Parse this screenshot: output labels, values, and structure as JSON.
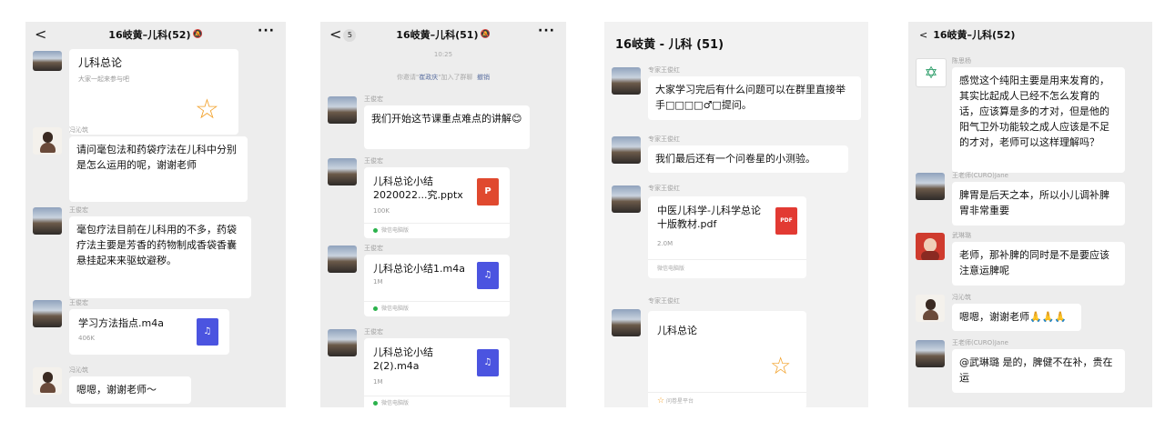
{
  "panel1": {
    "title": "16岐黄–儿科(52)",
    "mute": "🔕",
    "more": "···",
    "back": "<",
    "card_title": "儿科总论",
    "card_sub": "大家一起来参与吧",
    "name_feng": "冯沁筑",
    "msg_question": "请问毫包法和药袋疗法在儿科中分别是怎么运用的呢，谢谢老师",
    "name_wang": "王俊宏",
    "msg_answer": "毫包疗法目前在儿科用的不多，药袋疗法主要是芳香的药物制成香袋香囊悬挂起来来驱蚊避秽。",
    "file_name": "学习方法指点.m4a",
    "file_size": "406K",
    "msg_thanks": "嗯嗯，谢谢老师～"
  },
  "panel2": {
    "title": "16岐黄–儿科(51)",
    "back": "<",
    "unread": "5",
    "more": "···",
    "time": "10:25",
    "sys_prefix": "你邀请\"",
    "sys_name": "崔政庆",
    "sys_suffix": "\"加入了群聊",
    "sys_revoke": "撤销",
    "sender": "王俊宏",
    "msg_intro": "我们开始这节课重点难点的讲解😊",
    "file1_name": "儿科总论小结2020022...究.pptx",
    "file1_size": "100K",
    "file1_src": "微信电脑版",
    "file1_icon": "P",
    "file2_name": "儿科总论小结1.m4a",
    "file2_size": "1M",
    "file2_src": "微信电脑版",
    "file3_name": "儿科总论小结2(2).m4a",
    "file3_size": "1M",
    "file3_src": "微信电脑版",
    "audio_icon": "♫"
  },
  "panel3": {
    "title": "16岐黄 - 儿科 (51)",
    "sender": "专家王俊红",
    "msg1": "大家学习完后有什么问题可以在群里直接举手□□□□♂□提问。",
    "msg2": "我们最后还有一个问卷星的小测验。",
    "file_name": "中医儿科学-儿科学总论十版教材.pdf",
    "file_size": "2.0M",
    "file_src": "微信电脑版",
    "pdf_label": "PDF",
    "card_title": "儿科总论",
    "card_src": "问卷星平台"
  },
  "panel4": {
    "title": "16岐黄–儿科(52)",
    "back": "<",
    "name1": "陈思杨",
    "msg1": "感觉这个纯阳主要是用来发育的，其实比起成人已经不怎么发育的话，应该算是多的才对，但是他的阳气卫外功能较之成人应该是不足的才对，老师可以这样理解吗？",
    "name2": "王老师(CURO)Jane",
    "msg2": "脾胃是后天之本，所以小儿调补脾胃非常重要",
    "name3": "武琳璐",
    "msg3": "老师，那补脾的同时是不是要应该注意运脾呢",
    "name4": "冯沁筑",
    "msg4": "嗯嗯，谢谢老师🙏🙏🙏",
    "name5": "王老师(CURO)Jane",
    "msg5": "@武琳璐 是的，脾健不在补，贵在运"
  },
  "icons": {
    "star": "☆",
    "logo": "✡"
  },
  "colors": {
    "bubble": "#ffffff",
    "panel": "#ededed",
    "star": "#f2a12a",
    "ppt": "#e0492f",
    "audio": "#4b54e0",
    "pdf": "#e23a33"
  }
}
